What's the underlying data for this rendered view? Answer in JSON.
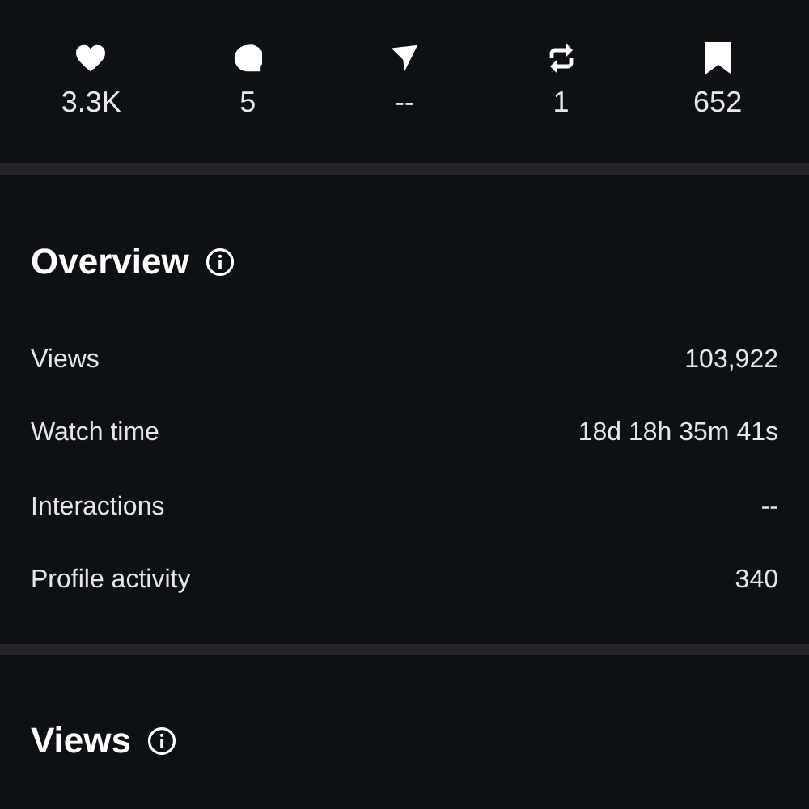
{
  "stats": [
    {
      "kind": "heart",
      "value": "3.3K"
    },
    {
      "kind": "comment",
      "value": "5"
    },
    {
      "kind": "share",
      "value": "--"
    },
    {
      "kind": "repost",
      "value": "1"
    },
    {
      "kind": "bookmark",
      "value": "652"
    }
  ],
  "overview": {
    "title": "Overview",
    "rows": [
      {
        "label": "Views",
        "value": "103,922"
      },
      {
        "label": "Watch time",
        "value": "18d 18h 35m 41s"
      },
      {
        "label": "Interactions",
        "value": "--"
      },
      {
        "label": "Profile activity",
        "value": "340"
      }
    ]
  },
  "views": {
    "title": "Views"
  }
}
